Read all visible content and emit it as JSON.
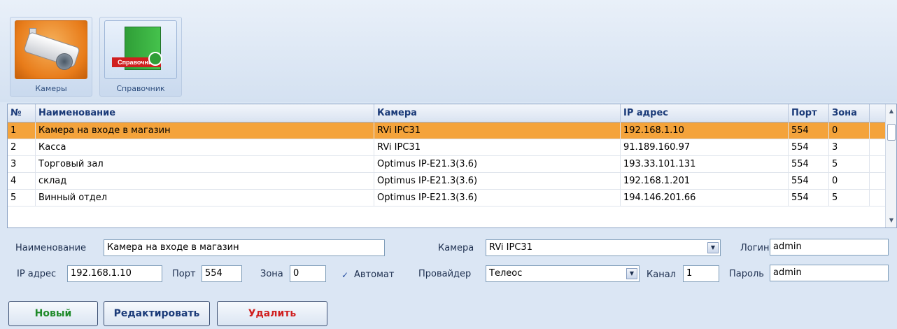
{
  "toolbar": {
    "cameras_label": "Камеры",
    "directory_label": "Справочник",
    "directory_badge": "Справочник",
    "cameras_icon": "security-camera-icon",
    "directory_icon": "book-directory-icon"
  },
  "table": {
    "headers": [
      "№",
      "Наименование",
      "Камера",
      "IP адрес",
      "Порт",
      "Зона"
    ],
    "rows": [
      [
        "1",
        "Камера на входе в магазин",
        "RVi IPC31",
        "192.168.1.10",
        "554",
        "0"
      ],
      [
        "2",
        "Касса",
        "RVi IPC31",
        "91.189.160.97",
        "554",
        "3"
      ],
      [
        "3",
        "Торговый зал",
        "Optimus IP-E21.3(3.6)",
        "193.33.101.131",
        "554",
        "5"
      ],
      [
        "4",
        "склад",
        "Optimus IP-E21.3(3.6)",
        "192.168.1.201",
        "554",
        "0"
      ],
      [
        "5",
        "Винный отдел",
        "Optimus IP-E21.3(3.6)",
        "194.146.201.66",
        "554",
        "5"
      ]
    ],
    "selected_row": 0,
    "selection_color": "#f4a33b"
  },
  "form": {
    "name_label": "Наименование",
    "name_value": "Камера на входе в магазин",
    "camera_label": "Камера",
    "camera_value": "RVi IPC31",
    "login_label": "Логин",
    "login_value": "admin",
    "ip_label": "IP адрес",
    "ip_value": "192.168.1.10",
    "port_label": "Порт",
    "port_value": "554",
    "zone_label": "Зона",
    "zone_value": "0",
    "auto_label": "Автомат",
    "auto_checked": true,
    "provider_label": "Провайдер",
    "provider_value": "Телеос",
    "channel_label": "Канал",
    "channel_value": "1",
    "password_label": "Пароль",
    "password_value": "admin"
  },
  "buttons": {
    "new_label": "Новый",
    "edit_label": "Редактировать",
    "delete_label": "Удалить",
    "new_color": "#1f8a2a",
    "edit_color": "#1a3a78",
    "delete_color": "#d01f1f"
  }
}
